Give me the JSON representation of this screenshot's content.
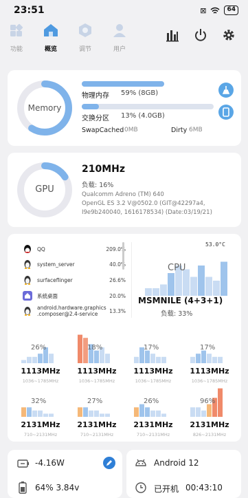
{
  "status": {
    "time": "23:51",
    "battery": "64"
  },
  "nav": {
    "tabs": [
      {
        "label": "功能",
        "icon": "grid-icon",
        "active": false
      },
      {
        "label": "概览",
        "icon": "home-icon",
        "active": true
      },
      {
        "label": "调节",
        "icon": "hexagon-icon",
        "active": false
      },
      {
        "label": "用户",
        "icon": "user-icon",
        "active": false
      }
    ]
  },
  "memory": {
    "ring_label": "Memory",
    "ram_label": "物理内存",
    "ram_value": "59% (8GB)",
    "ram_fraction": 0.59,
    "swap_label": "交换分区",
    "swap_value": "13% (4.0GB)",
    "swap_fraction": 0.13,
    "swapcached_label": "SwapCached",
    "swapcached_value": "0MB",
    "dirty_label": "Dirty",
    "dirty_value": "6MB",
    "ring_fraction": 0.59
  },
  "gpu": {
    "ring_label": "GPU",
    "freq": "210MHz",
    "load": "负载:  16%",
    "load_fraction": 0.16,
    "renderer": "Qualcomm Adreno (TM) 640",
    "gl_line1": "OpenGL ES 3.2 V@0502.0 (GIT@42297a4,",
    "gl_line2": "I9e9b240040, 1616178534) (Date:03/19/21)"
  },
  "cpu": {
    "temp": "53.0°C",
    "label": "CPU",
    "name": "MSMNILE (4+3+1)",
    "load": "负载:  33%",
    "processes": [
      {
        "name": "QQ",
        "pct": "209.0%",
        "icon": "qq-penguin-icon"
      },
      {
        "name": "system_server",
        "pct": "40.0%",
        "icon": "linux-penguin-icon"
      },
      {
        "name": "surfaceflinger",
        "pct": "26.6%",
        "icon": "linux-penguin-icon"
      },
      {
        "name": "系统桌面",
        "pct": "20.0%",
        "icon": "launcher-icon"
      },
      {
        "name": "android.hardware.graphics\n.composer@2.4-service",
        "pct": "13.3%",
        "icon": "linux-penguin-icon"
      }
    ],
    "cores": [
      {
        "pct": "26%",
        "freq": "1113MHz",
        "range": "1036~1785MHz"
      },
      {
        "pct": "18%",
        "freq": "1113MHz",
        "range": "1036~1785MHz"
      },
      {
        "pct": "17%",
        "freq": "1113MHz",
        "range": "1036~1785MHz"
      },
      {
        "pct": "17%",
        "freq": "1113MHz",
        "range": "1036~1785MHz"
      },
      {
        "pct": "32%",
        "freq": "2131MHz",
        "range": "710~2131MHz"
      },
      {
        "pct": "27%",
        "freq": "2131MHz",
        "range": "710~2131MHz"
      },
      {
        "pct": "26%",
        "freq": "2131MHz",
        "range": "710~2131MHz"
      },
      {
        "pct": "96%",
        "freq": "2131MHz",
        "range": "826~2131MHz"
      }
    ]
  },
  "power": {
    "watts": "-4.16W",
    "battery": "64%  3.84v"
  },
  "system": {
    "android": "Android 12",
    "uptime_label": "已开机",
    "uptime": "00:43:10"
  },
  "colors": {
    "accent": "#5aa6e6",
    "ring": "#7fb3ea",
    "track": "#e8e8ee",
    "hot": "#f08a6a",
    "warm": "#f5b878"
  }
}
